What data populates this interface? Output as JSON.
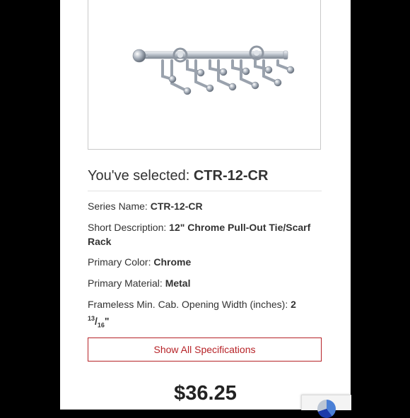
{
  "product_image": {
    "alt_icon": "tie-rack-image"
  },
  "selection": {
    "prefix": "You've selected:",
    "code": "CTR-12-CR"
  },
  "specs": {
    "series_label": "Series Name:",
    "series_value": "CTR-12-CR",
    "desc_label": "Short Description:",
    "desc_value": "12\" Chrome Pull-Out Tie/Scarf Rack",
    "color_label": "Primary Color:",
    "color_value": "Chrome",
    "material_label": "Primary Material:",
    "material_value": "Metal",
    "width_label": "Frameless Min. Cab. Opening Width (inches):",
    "width_whole": "2",
    "width_num": "13",
    "width_den": "16",
    "width_unit": "\""
  },
  "actions": {
    "show_all_label": "Show All Specifications"
  },
  "price": "$36.25",
  "colors": {
    "accent": "#b62227",
    "background": "#000000",
    "panel": "#ffffff"
  }
}
